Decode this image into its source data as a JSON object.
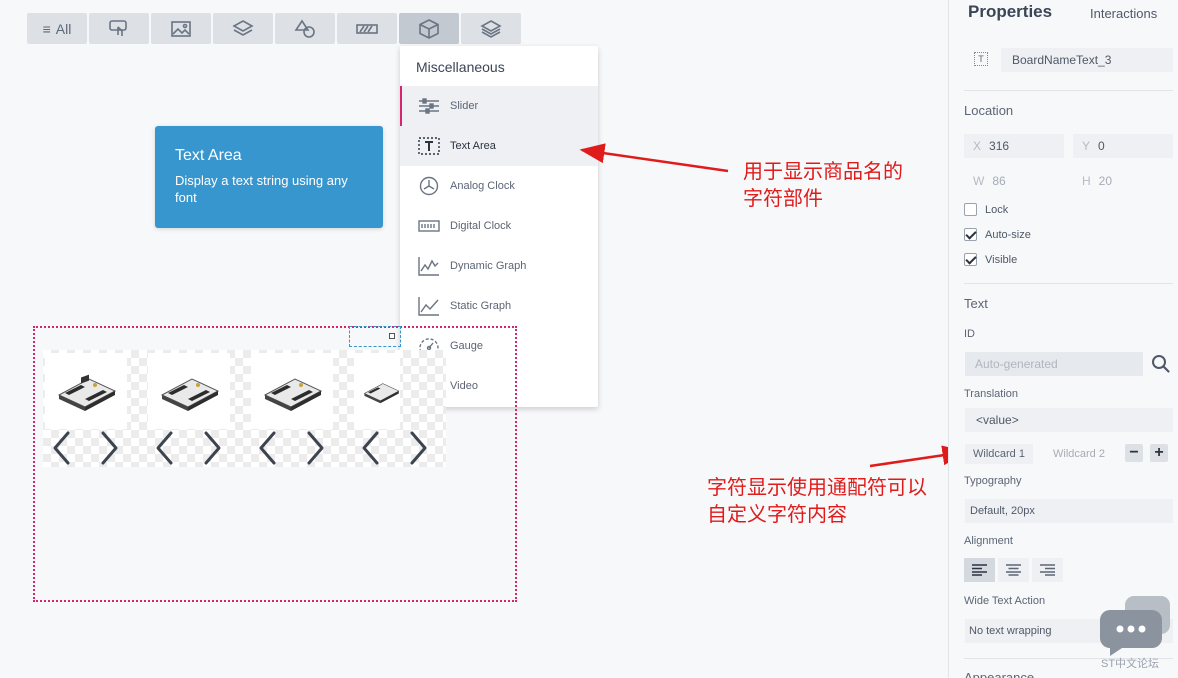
{
  "toolbar": {
    "all_label": "All",
    "buttons": [
      {
        "icon": "touch-icon"
      },
      {
        "icon": "image-icon"
      },
      {
        "icon": "layers-icon"
      },
      {
        "icon": "shapes-icon"
      },
      {
        "icon": "progress-icon"
      },
      {
        "icon": "cube-icon",
        "active": true
      },
      {
        "icon": "stack-icon"
      }
    ]
  },
  "dropdown": {
    "title": "Miscellaneous",
    "items": [
      {
        "label": "Slider",
        "icon": "slider-icon"
      },
      {
        "label": "Text Area",
        "icon": "text-area-icon"
      },
      {
        "label": "Analog Clock",
        "icon": "analog-clock-icon"
      },
      {
        "label": "Digital Clock",
        "icon": "digital-clock-icon"
      },
      {
        "label": "Dynamic Graph",
        "icon": "dynamic-graph-icon"
      },
      {
        "label": "Static Graph",
        "icon": "static-graph-icon"
      },
      {
        "label": "Gauge",
        "icon": "gauge-icon"
      },
      {
        "label": "Video",
        "icon": "video-icon"
      }
    ]
  },
  "tooltip": {
    "title": "Text Area",
    "description": "Display a text string using any font"
  },
  "annotations": {
    "first_line1": "用于显示商品名的",
    "first_line2": "字符部件",
    "second_line1": "字符显示使用通配符可以",
    "second_line2": "自定义字符内容"
  },
  "panel": {
    "tab_properties": "Properties",
    "tab_interactions": "Interactions",
    "name_value": "BoardNameText_3",
    "location_title": "Location",
    "x_label": "X",
    "x_value": "316",
    "y_label": "Y",
    "y_value": "0",
    "w_label": "W",
    "w_value": "86",
    "h_label": "H",
    "h_value": "20",
    "lock_label": "Lock",
    "autosize_label": "Auto-size",
    "visible_label": "Visible",
    "text_title": "Text",
    "id_label": "ID",
    "id_placeholder": "Auto-generated",
    "translation_label": "Translation",
    "translation_value": "<value>",
    "wildcard1": "Wildcard 1",
    "wildcard2": "Wildcard 2",
    "minus": "−",
    "plus": "+",
    "typography_label": "Typography",
    "typography_value": "Default, 20px",
    "alignment_label": "Alignment",
    "wide_text_label": "Wide Text Action",
    "wide_text_value": "No text wrapping",
    "appearance_title": "Appearance"
  },
  "watermark": {
    "text": "ST中文论坛"
  }
}
